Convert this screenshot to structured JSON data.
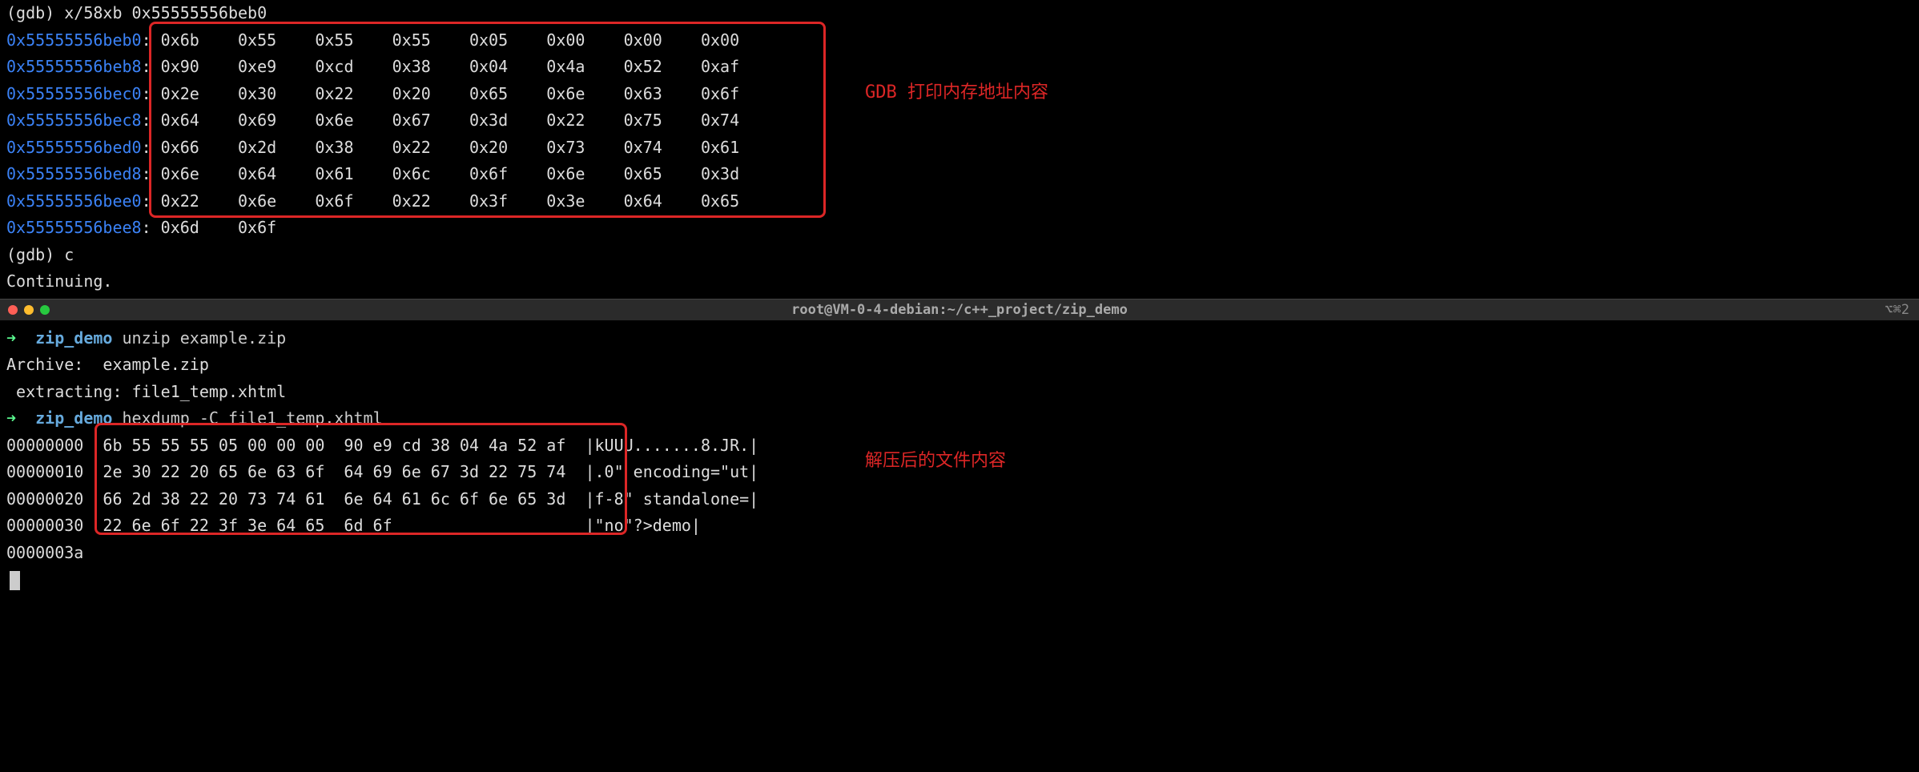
{
  "gdb": {
    "cmd1": "(gdb) x/58xb 0x55555556beb0",
    "rows": [
      {
        "addr": "0x55555556beb0",
        "vals": [
          "0x6b",
          "0x55",
          "0x55",
          "0x55",
          "0x05",
          "0x00",
          "0x00",
          "0x00"
        ]
      },
      {
        "addr": "0x55555556beb8",
        "vals": [
          "0x90",
          "0xe9",
          "0xcd",
          "0x38",
          "0x04",
          "0x4a",
          "0x52",
          "0xaf"
        ]
      },
      {
        "addr": "0x55555556bec0",
        "vals": [
          "0x2e",
          "0x30",
          "0x22",
          "0x20",
          "0x65",
          "0x6e",
          "0x63",
          "0x6f"
        ]
      },
      {
        "addr": "0x55555556bec8",
        "vals": [
          "0x64",
          "0x69",
          "0x6e",
          "0x67",
          "0x3d",
          "0x22",
          "0x75",
          "0x74"
        ]
      },
      {
        "addr": "0x55555556bed0",
        "vals": [
          "0x66",
          "0x2d",
          "0x38",
          "0x22",
          "0x20",
          "0x73",
          "0x74",
          "0x61"
        ]
      },
      {
        "addr": "0x55555556bed8",
        "vals": [
          "0x6e",
          "0x64",
          "0x61",
          "0x6c",
          "0x6f",
          "0x6e",
          "0x65",
          "0x3d"
        ]
      },
      {
        "addr": "0x55555556bee0",
        "vals": [
          "0x22",
          "0x6e",
          "0x6f",
          "0x22",
          "0x3f",
          "0x3e",
          "0x64",
          "0x65"
        ]
      },
      {
        "addr": "0x55555556bee8",
        "vals": [
          "0x6d",
          "0x6f"
        ]
      }
    ],
    "cmd2": "(gdb) c",
    "continuing": "Continuing."
  },
  "annotation1": "GDB 打印内存地址内容",
  "titlebar": {
    "title": "root@VM-0-4-debian:~/c++_project/zip_demo",
    "right": "⌥⌘2"
  },
  "shell": {
    "arrow": "➜",
    "dir": "zip_demo",
    "cmd_unzip": "unzip example.zip",
    "archive": "Archive:  example.zip",
    "extracting": " extracting: file1_temp.xhtml",
    "cmd_hexdump": "hexdump -C file1_temp.xhtml",
    "hexdump": [
      {
        "off": "00000000",
        "hex": "6b 55 55 55 05 00 00 00  90 e9 cd 38 04 4a 52 af",
        "asc": "|kUUU.......8.JR.|"
      },
      {
        "off": "00000010",
        "hex": "2e 30 22 20 65 6e 63 6f  64 69 6e 67 3d 22 75 74",
        "asc": "|.0\" encoding=\"ut|"
      },
      {
        "off": "00000020",
        "hex": "66 2d 38 22 20 73 74 61  6e 64 61 6c 6f 6e 65 3d",
        "asc": "|f-8\" standalone=|"
      },
      {
        "off": "00000030",
        "hex": "22 6e 6f 22 3f 3e 64 65  6d 6f",
        "asc": "|\"no\"?>demo|"
      }
    ],
    "hexdump_end": "0000003a"
  },
  "annotation2": "解压后的文件内容"
}
